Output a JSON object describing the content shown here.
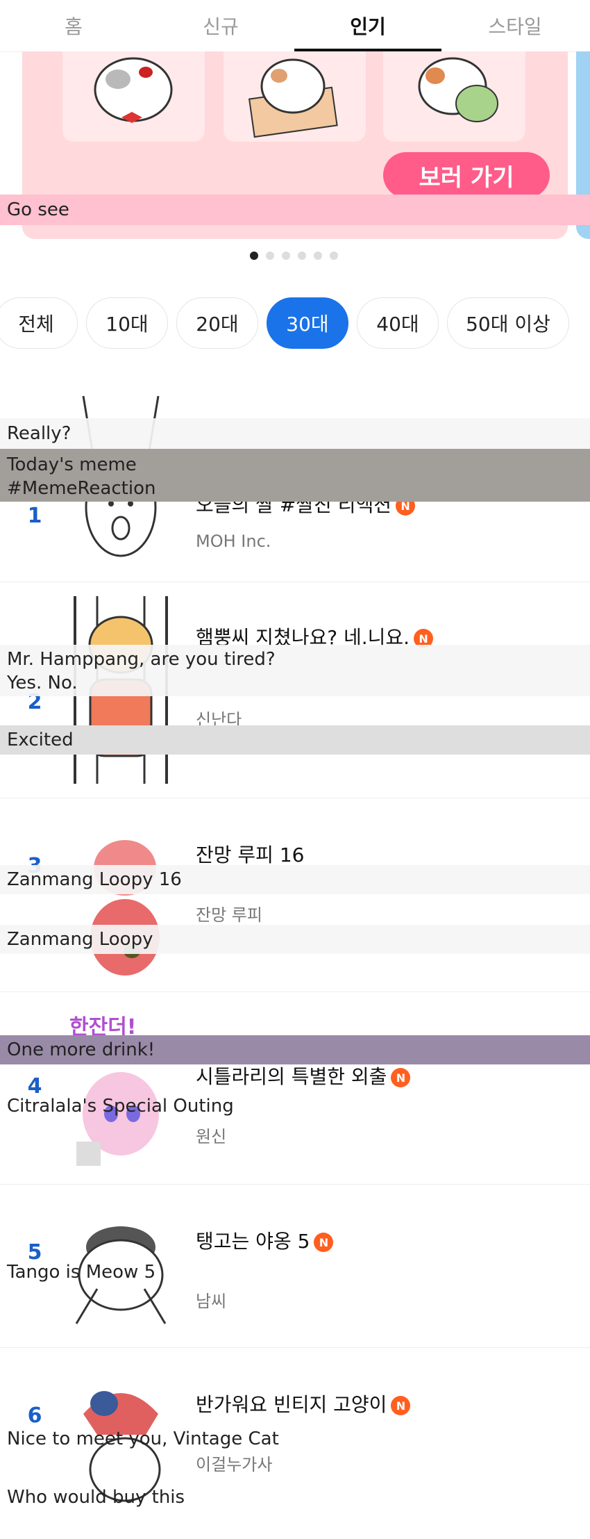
{
  "tabs": [
    {
      "label": "홈"
    },
    {
      "label": "신규"
    },
    {
      "label": "인기"
    },
    {
      "label": "스타일"
    }
  ],
  "banner": {
    "button_label": "보러 가기",
    "caption": "Go see",
    "dots_count": 6,
    "active_dot": 1
  },
  "age_filters": [
    "전체",
    "10대",
    "20대",
    "30대",
    "40대",
    "50대 이상"
  ],
  "selected_age": "30대",
  "ranking": [
    {
      "rank": "1",
      "title": "오늘의 짤 #짤진 리액션",
      "author": "MOH Inc.",
      "is_new": true,
      "overlays": [
        "Really?",
        "Today's meme\n#MemeReaction"
      ]
    },
    {
      "rank": "2",
      "title": "햄뿡씨 지쳤나요? 네.니요.",
      "author": "신난다",
      "is_new": true,
      "overlays": [
        "Mr. Hamppang, are you tired?\nYes. No.",
        "Excited"
      ]
    },
    {
      "rank": "3",
      "title": "잔망 루피 16",
      "author": "잔망 루피",
      "is_new": false,
      "overlays": [
        "Zanmang Loopy 16",
        "Zanmang Loopy"
      ]
    },
    {
      "rank": "4",
      "title": "시틀라리의 특별한 외출",
      "author": "원신",
      "is_new": true,
      "overlays": [
        "One more drink!",
        "Citralala's Special Outing"
      ]
    },
    {
      "rank": "5",
      "title": "탱고는 야옹 5",
      "author": "남씨",
      "is_new": true,
      "overlays": [
        "Tango is Meow 5"
      ]
    },
    {
      "rank": "6",
      "title": "반가워요 빈티지 고양이",
      "author": "이걸누가사",
      "is_new": true,
      "overlays": [
        "Nice to meet you, Vintage Cat",
        "Who would buy this"
      ]
    }
  ],
  "colors": {
    "accent_blue": "#1a73e8",
    "rank_blue": "#1a5fc8",
    "new_badge": "#ff5f1f",
    "banner_bg": "#ffd9dc",
    "banner_button": "#ff5c8a"
  },
  "new_badge_label": "N"
}
